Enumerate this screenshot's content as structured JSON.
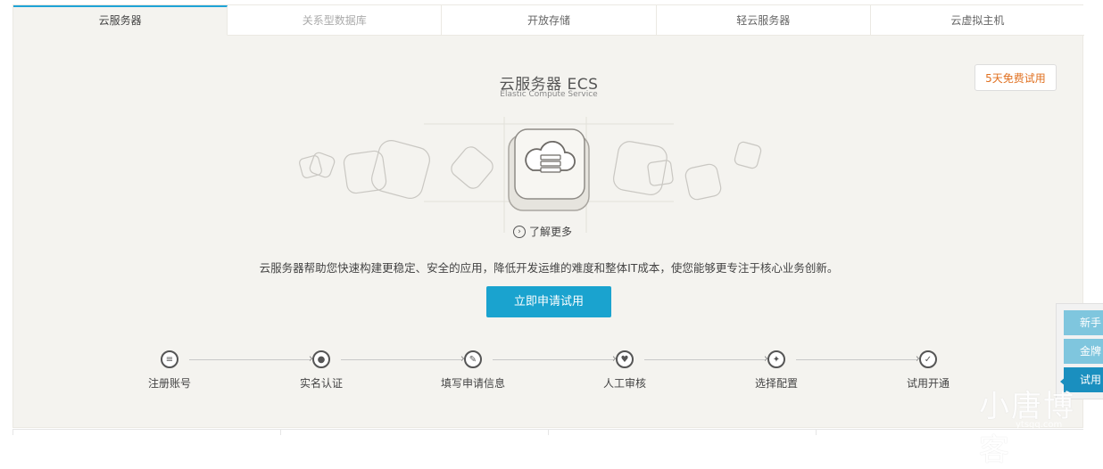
{
  "tabs": [
    {
      "label": "云服务器",
      "active": true
    },
    {
      "label": "关系型数据库",
      "active": false
    },
    {
      "label": "开放存储",
      "active": false
    },
    {
      "label": "轻云服务器",
      "active": false
    },
    {
      "label": "云虚拟主机",
      "active": false
    }
  ],
  "product": {
    "title": "云服务器 ECS",
    "subtitle": "Elastic Compute Service",
    "trial_badge": "5天免费试用",
    "learn_more": "了解更多",
    "description": "云服务器帮助您快速构建更稳定、安全的应用，降低开发运维的难度和整体IT成本，使您能够更专注于核心业务创新。",
    "cta": "立即申请试用"
  },
  "steps": [
    {
      "label": "注册账号",
      "icon": "list-icon"
    },
    {
      "label": "实名认证",
      "icon": "user-icon"
    },
    {
      "label": "填写申请信息",
      "icon": "pencil-icon"
    },
    {
      "label": "人工审核",
      "icon": "heart-icon"
    },
    {
      "label": "选择配置",
      "icon": "wrench-icon"
    },
    {
      "label": "试用开通",
      "icon": "check-icon"
    }
  ],
  "side_float": {
    "items": [
      "新手",
      "金牌",
      "试用"
    ]
  },
  "watermark": {
    "text": "小唐博客",
    "sub": "ytsgq.com"
  },
  "colors": {
    "accent": "#1aa3cf",
    "badge_text": "#e07020",
    "panel_bg": "#f4f3ef"
  }
}
